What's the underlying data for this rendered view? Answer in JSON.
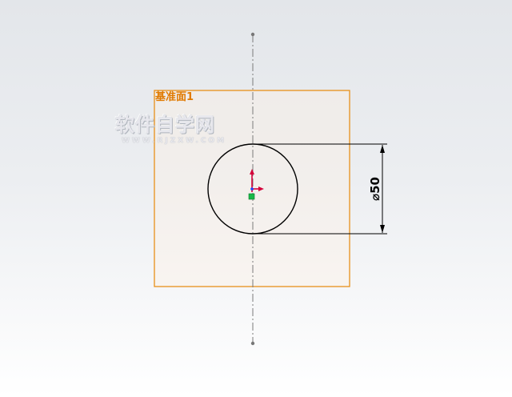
{
  "plane": {
    "name": "基准面1",
    "color": "#e8901a"
  },
  "sketch": {
    "circle_diameter_label": "⌀50",
    "line_color": "#000000"
  },
  "watermark": {
    "title": "软件自学网",
    "url": "WWW.RJZXW.COM"
  },
  "icons": {
    "origin": "origin-triad-icon",
    "endpoint": "centerline-endpoint-icon"
  }
}
